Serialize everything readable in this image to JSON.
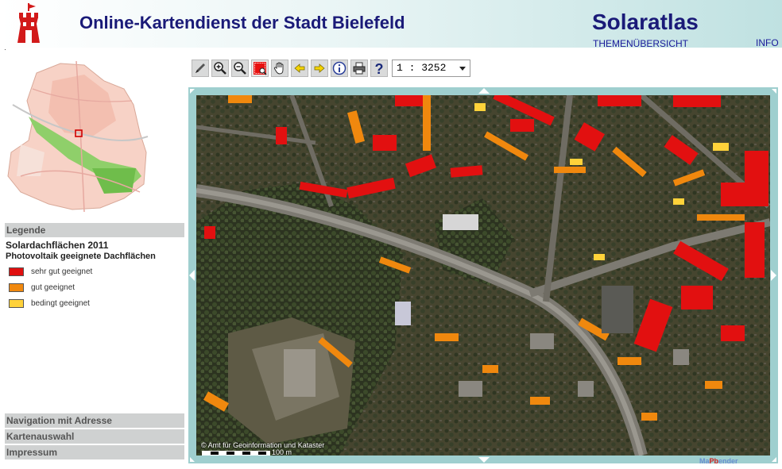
{
  "header": {
    "title": "Online-Kartendienst der Stadt Bielefeld",
    "brand": "Solaratlas",
    "brand_sub": "THEMENÜBERSICHT",
    "info_link": "INFO"
  },
  "toolbar": {
    "tools": [
      "pen-icon",
      "zoom-in-icon",
      "zoom-out-icon",
      "zoom-rect-icon",
      "pan-hand-icon",
      "back-arrow-icon",
      "forward-arrow-icon",
      "info-icon",
      "print-icon",
      "help-icon"
    ],
    "scale": "1 : 3252"
  },
  "legend": {
    "header": "Legende",
    "title": "Solardachflächen 2011",
    "subtitle": "Photovoltaik geeignete Dachflächen",
    "items": [
      {
        "label": "sehr gut geeignet",
        "color": "#e00f0f"
      },
      {
        "label": "gut geeignet",
        "color": "#f0880e"
      },
      {
        "label": "bedingt geeignet",
        "color": "#ffd23a"
      }
    ]
  },
  "panels": {
    "navigation": "Navigation mit Adresse",
    "kartenauswahl": "Kartenauswahl",
    "impressum": "Impressum"
  },
  "map": {
    "attribution": "© Amt für Geoinformation und Kataster",
    "scalebar_label": "100 m",
    "mapbender_prefix": "Ma",
    "mapbender_mid": "Pb",
    "mapbender_suffix": "ender",
    "frame_color": "#9fcfcf"
  }
}
